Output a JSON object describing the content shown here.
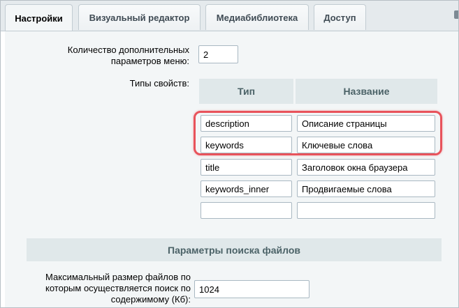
{
  "tabs": [
    {
      "label": "Настройки"
    },
    {
      "label": "Визуальный редактор"
    },
    {
      "label": "Медиабиблиотека"
    },
    {
      "label": "Доступ"
    }
  ],
  "menu_params": {
    "label": "Количество дополнительных параметров меню:",
    "value": "2"
  },
  "property_types": {
    "label": "Типы свойств:",
    "col_type": "Тип",
    "col_name": "Название",
    "rows": [
      {
        "type": "description",
        "name": "Описание страницы"
      },
      {
        "type": "keywords",
        "name": "Ключевые слова"
      },
      {
        "type": "title",
        "name": "Заголовок окна браузера"
      },
      {
        "type": "keywords_inner",
        "name": "Продвигаемые слова"
      },
      {
        "type": "",
        "name": ""
      }
    ]
  },
  "file_search": {
    "section_title": "Параметры поиска файлов",
    "max_size_label": "Максимальный размер файлов по которым осуществляется поиск по содержимому (Кб):",
    "max_size_value": "1024"
  },
  "colors": {
    "highlight": "#e8535b",
    "header_bg": "#e0e8ea"
  }
}
